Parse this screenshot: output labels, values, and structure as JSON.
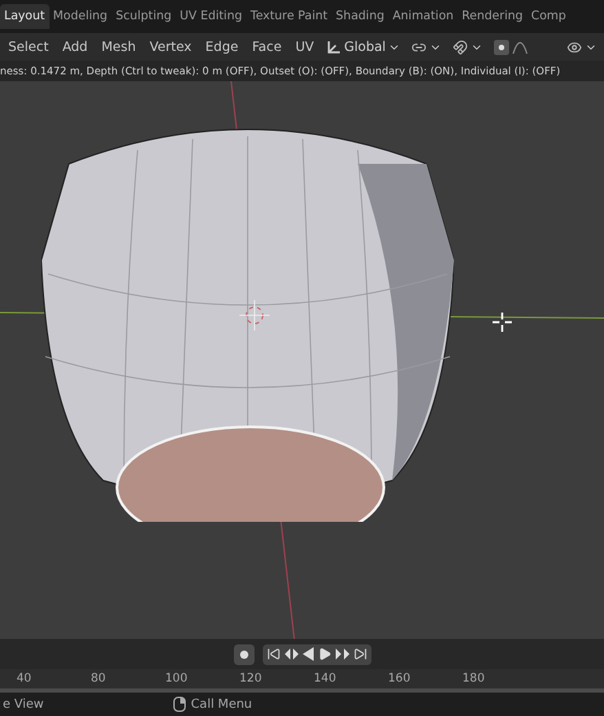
{
  "workspace_tabs": [
    {
      "label": "Layout",
      "selected": true
    },
    {
      "label": "Modeling",
      "selected": false
    },
    {
      "label": "Sculpting",
      "selected": false
    },
    {
      "label": "UV Editing",
      "selected": false
    },
    {
      "label": "Texture Paint",
      "selected": false
    },
    {
      "label": "Shading",
      "selected": false
    },
    {
      "label": "Animation",
      "selected": false
    },
    {
      "label": "Rendering",
      "selected": false
    },
    {
      "label": "Comp",
      "selected": false
    }
  ],
  "header_menu": [
    "Select",
    "Add",
    "Mesh",
    "Vertex",
    "Edge",
    "Face",
    "UV"
  ],
  "orientation": {
    "label": "Global"
  },
  "operator_status": "ness: 0.1472 m, Depth (Ctrl to tweak): 0 m (OFF), Outset (O): (OFF), Boundary (B): (ON), Individual (I): (OFF)",
  "timeline": {
    "ruler": [
      "40",
      "80",
      "100",
      "120",
      "140",
      "160",
      "180"
    ]
  },
  "status_bar": [
    {
      "kind": "text",
      "label": "e View"
    },
    {
      "kind": "mouse",
      "label": "Call Menu"
    }
  ]
}
